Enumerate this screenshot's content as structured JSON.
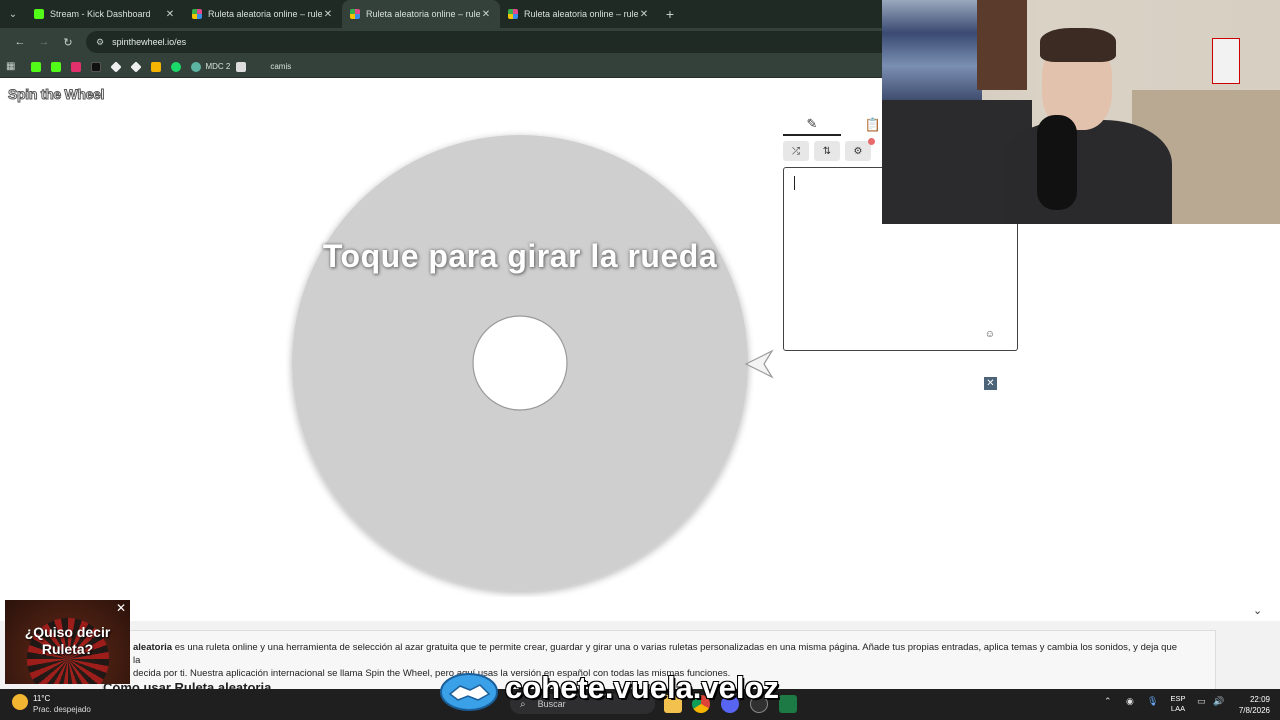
{
  "browser": {
    "tabs": [
      {
        "title": "Stream - Kick Dashboard",
        "favicon_color": "#53fc18",
        "active": false
      },
      {
        "title": "Ruleta aleatoria online – ruleta",
        "favicon_color": "#e04a8c",
        "active": false
      },
      {
        "title": "Ruleta aleatoria online – ruleta",
        "favicon_color": "#e04a8c",
        "active": true
      },
      {
        "title": "Ruleta aleatoria online – ruleta",
        "favicon_color": "#e04a8c",
        "active": false
      }
    ],
    "url": "spinthewheel.io/es",
    "bookmarks": [
      {
        "label": "",
        "color": "#53fc18"
      },
      {
        "label": "",
        "color": "#53fc18"
      },
      {
        "label": "",
        "color": "#e1306c"
      },
      {
        "label": "",
        "color": "#111111"
      },
      {
        "label": "",
        "color": "#eeeeee"
      },
      {
        "label": "",
        "color": "#eeeeee"
      },
      {
        "label": "",
        "color": "#f5b400"
      },
      {
        "label": "",
        "color": "#1bd96a"
      },
      {
        "label": "MDC 2",
        "color": "#5bb5a2"
      },
      {
        "label": "",
        "color": "#dddddd"
      },
      {
        "label": "camis",
        "color": "#33413a"
      }
    ]
  },
  "page": {
    "logo": "Spin the Wheel",
    "spin_prompt": "Toque para girar la rueda",
    "panel": {
      "close_symbol": "✕"
    },
    "info": {
      "bold": "aleatoria",
      "text": " es una ruleta online y una herramienta de selección al azar gratuita que te permite crear, guardar y girar una o varias ruletas personalizadas en una misma página. Añade tus propias entradas, aplica temas y cambia los sonidos, y deja que la",
      "text2": "decida por ti. Nuestra aplicación internacional se llama Spin the Wheel, pero aquí usas la versión en español con todas las mismas funciones.",
      "how_title": "Cómo usar Ruleta aleatoria"
    },
    "ad": {
      "text": "¿Quiso decir Ruleta?"
    }
  },
  "overlay": {
    "text": "cohete.vuela.veloz"
  },
  "taskbar": {
    "weather_temp": "11°C",
    "weather_desc": "Prac. despejado",
    "search_placeholder": "Buscar",
    "lang_top": "ESP",
    "lang_bottom": "LAA",
    "time": "22:09",
    "date": "7/8/2026"
  }
}
